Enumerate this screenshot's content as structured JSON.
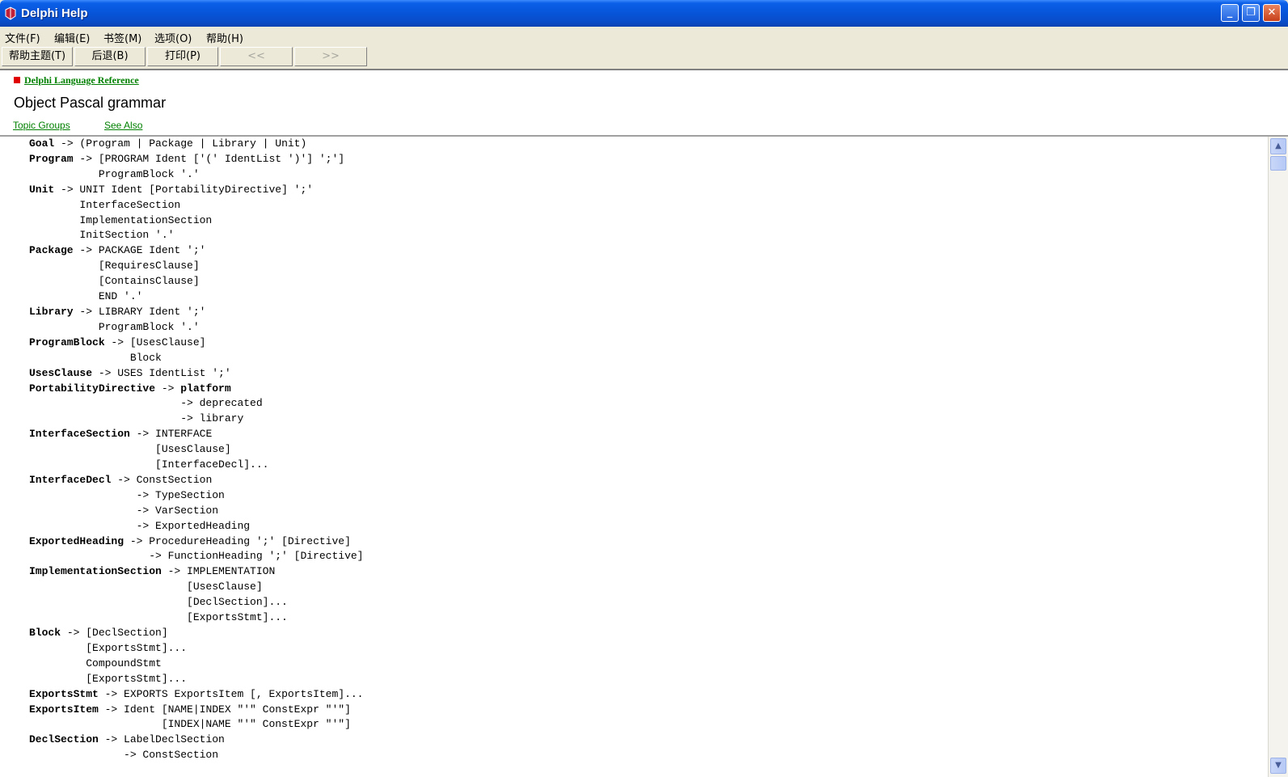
{
  "window": {
    "title": "Delphi Help"
  },
  "menu": [
    {
      "label": "文件(F)"
    },
    {
      "label": "编辑(E)"
    },
    {
      "label": "书签(M)"
    },
    {
      "label": "选项(O)"
    },
    {
      "label": "帮助(H)"
    }
  ],
  "toolbar": {
    "help_topics": "帮助主题(T)",
    "back": "后退(B)",
    "print": "打印(P)",
    "prev": "<<",
    "next": ">>"
  },
  "header": {
    "breadcrumb": "Delphi Language Reference",
    "title": "Object Pascal grammar",
    "links": [
      "Topic Groups",
      "See Also"
    ]
  },
  "grammar": [
    [
      "Goal",
      " -> (Program | Package | Library | Unit)"
    ],
    [
      "Program",
      " -> [PROGRAM Ident ['(' IdentList ')'] ';']"
    ],
    [
      "",
      "           ProgramBlock '.'"
    ],
    [
      "Unit",
      " -> UNIT Ident [PortabilityDirective] ';'"
    ],
    [
      "",
      "        InterfaceSection"
    ],
    [
      "",
      "        ImplementationSection"
    ],
    [
      "",
      "        InitSection '.'"
    ],
    [
      "Package",
      " -> PACKAGE Ident ';'"
    ],
    [
      "",
      "           [RequiresClause]"
    ],
    [
      "",
      "           [ContainsClause]"
    ],
    [
      "",
      "           END '.'"
    ],
    [
      "Library",
      " -> LIBRARY Ident ';'"
    ],
    [
      "",
      "           ProgramBlock '.'"
    ],
    [
      "ProgramBlock",
      " -> [UsesClause]"
    ],
    [
      "",
      "                Block"
    ],
    [
      "UsesClause",
      " -> USES IdentList ';'"
    ],
    [
      "PortabilityDirective",
      " -> ",
      "platform"
    ],
    [
      "",
      "                        -> deprecated"
    ],
    [
      "",
      "                        -> library"
    ],
    [
      "InterfaceSection",
      " -> INTERFACE"
    ],
    [
      "",
      "                    [UsesClause]"
    ],
    [
      "",
      "                    [InterfaceDecl]..."
    ],
    [
      "InterfaceDecl",
      " -> ConstSection"
    ],
    [
      "",
      "                 -> TypeSection"
    ],
    [
      "",
      "                 -> VarSection"
    ],
    [
      "",
      "                 -> ExportedHeading"
    ],
    [
      "ExportedHeading",
      " -> ProcedureHeading ';' [Directive]"
    ],
    [
      "",
      "                   -> FunctionHeading ';' [Directive]"
    ],
    [
      "ImplementationSection",
      " -> IMPLEMENTATION"
    ],
    [
      "",
      "                         [UsesClause]"
    ],
    [
      "",
      "                         [DeclSection]..."
    ],
    [
      "",
      "                         [ExportsStmt]..."
    ],
    [
      "Block",
      " -> [DeclSection]"
    ],
    [
      "",
      "         [ExportsStmt]..."
    ],
    [
      "",
      "         CompoundStmt"
    ],
    [
      "",
      "         [ExportsStmt]..."
    ],
    [
      "ExportsStmt",
      " -> EXPORTS ExportsItem [, ExportsItem]..."
    ],
    [
      "ExportsItem",
      " -> Ident [NAME|INDEX \"'\" ConstExpr \"'\"]"
    ],
    [
      "",
      "                     [INDEX|NAME \"'\" ConstExpr \"'\"]"
    ],
    [
      "DeclSection",
      " -> LabelDeclSection"
    ],
    [
      "",
      "               -> ConstSection"
    ]
  ]
}
